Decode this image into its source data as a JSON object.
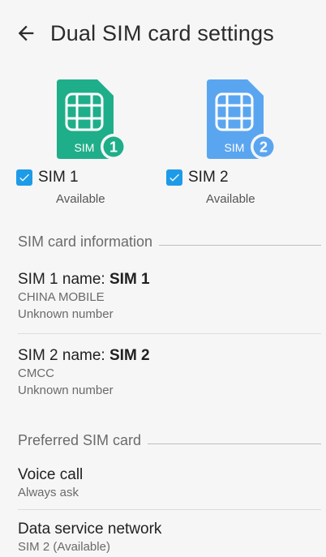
{
  "header": {
    "title": "Dual SIM card settings",
    "back_icon": "arrow-left-icon"
  },
  "sims": [
    {
      "card_label": "SIM",
      "number": "1",
      "checkbox_label": "SIM 1",
      "status": "Available",
      "color": "#1fae8a",
      "badge_color": "#1fae8a",
      "checked": true
    },
    {
      "card_label": "SIM",
      "number": "2",
      "checkbox_label": "SIM 2",
      "status": "Available",
      "color": "#5aa5f0",
      "badge_color": "#5aa5f0",
      "checked": true
    }
  ],
  "sim_info": {
    "section_title": "SIM card information",
    "items": [
      {
        "prefix": "SIM 1 name: ",
        "name": "SIM 1",
        "carrier": "CHINA MOBILE",
        "number": "Unknown number"
      },
      {
        "prefix": "SIM 2 name: ",
        "name": "SIM 2",
        "carrier": "CMCC",
        "number": "Unknown number"
      }
    ]
  },
  "preferred": {
    "section_title": "Preferred SIM card",
    "items": [
      {
        "title": "Voice call",
        "value": "Always ask"
      },
      {
        "title": "Data service network",
        "value": "SIM 2 (Available)"
      }
    ]
  },
  "colors": {
    "accent": "#1e9be8",
    "background": "#f6f6f6"
  }
}
